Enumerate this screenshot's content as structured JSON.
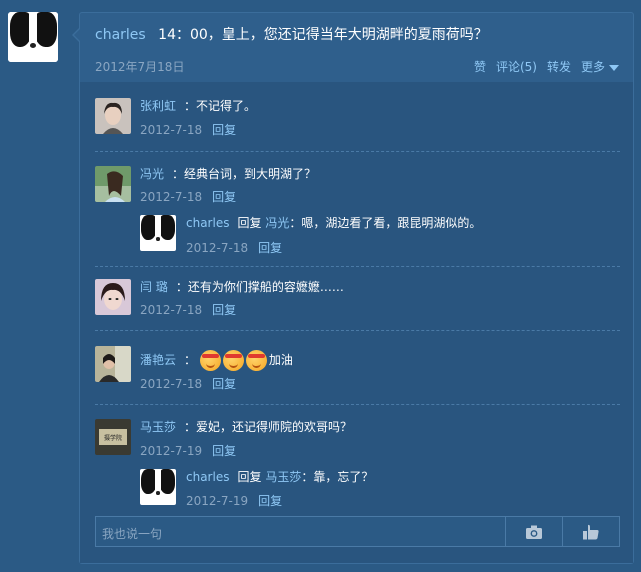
{
  "post": {
    "author": "charles",
    "text": "14：00，皇上，您还记得当年大明湖畔的夏雨荷吗？",
    "date": "2012年7月18日",
    "actions": {
      "like": "赞",
      "comment": "评论(5)",
      "forward": "转发",
      "more": "更多"
    }
  },
  "comments": [
    {
      "name": "张利虹",
      "text": "：不记得了。",
      "date": "2012-7-18",
      "reply_label": "回复"
    },
    {
      "name": "冯光",
      "text": "：经典台词，到大明湖了？",
      "date": "2012-7-18",
      "reply_label": "回复",
      "replies": [
        {
          "name": "charles",
          "reply_word": "回复",
          "reply_to": "冯光",
          "text": "：嗯，湖边看了看，跟昆明湖似的。",
          "date": "2012-7-18",
          "reply_label": "回复"
        }
      ]
    },
    {
      "name": "闫 璐",
      "text": "：还有为你们撑船的容嬷嬷……",
      "date": "2012-7-18",
      "reply_label": "回复"
    },
    {
      "name": "潘艳云",
      "text_prefix": "：",
      "text_suffix": "加油",
      "date": "2012-7-18",
      "reply_label": "回复"
    },
    {
      "name": "马玉莎",
      "text": "：爱妃，还记得师院的欢哥吗？",
      "date": "2012-7-19",
      "reply_label": "回复",
      "avatar_text": "摄学院",
      "replies": [
        {
          "name": "charles",
          "reply_word": "回复",
          "reply_to": "马玉莎",
          "text": "：靠，忘了？",
          "date": "2012-7-19",
          "reply_label": "回复"
        }
      ]
    }
  ],
  "input": {
    "placeholder": "我也说一句"
  },
  "icons": {
    "camera": "camera-icon",
    "thumb": "thumbs-up-icon"
  },
  "colors": {
    "background": "#2b5a85",
    "link": "#8fc8f5",
    "meta": "#8aa6c2"
  }
}
